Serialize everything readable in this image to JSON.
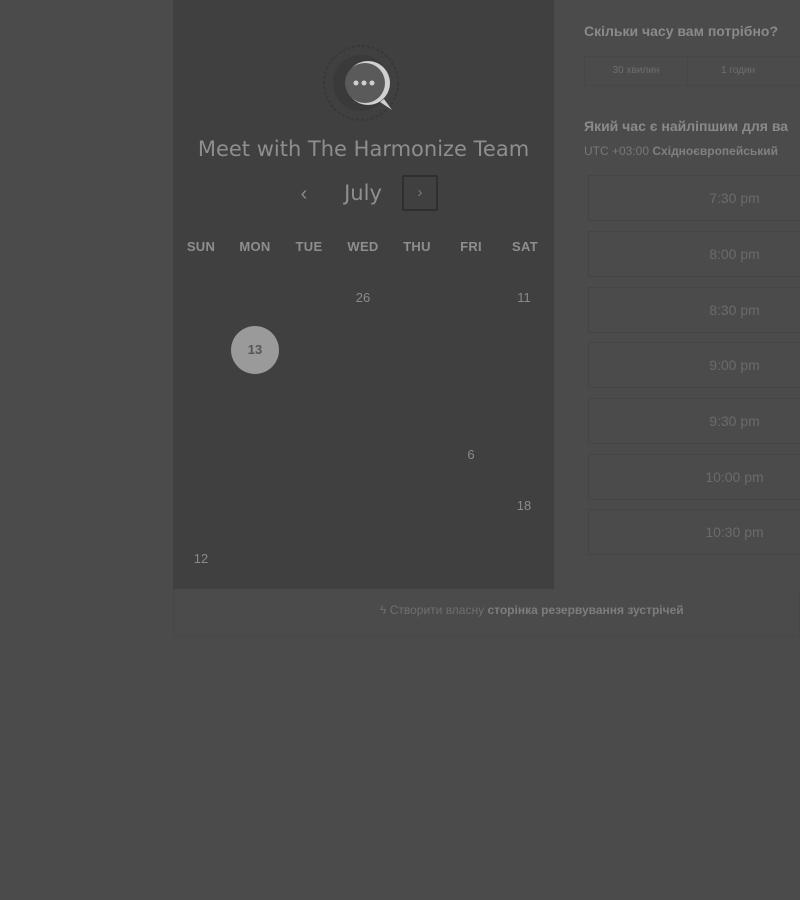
{
  "calendar": {
    "title": "Meet with The Harmonize Team",
    "month": "July",
    "prev_icon": "‹",
    "next_icon": "›",
    "weekdays": [
      "SUN",
      "MON",
      "TUE",
      "WED",
      "THU",
      "FRI",
      "SAT"
    ],
    "days": {
      "d26": "26",
      "d11": "11",
      "d13": "13",
      "d6": "6",
      "d18": "18",
      "d12": "12"
    },
    "selected_day": "13"
  },
  "booking": {
    "duration_question": "Скільки часу вам потрібно?",
    "durations": [
      "30 хвилин",
      "1 годин"
    ],
    "best_time_question": "Який час є найліпшим для ва",
    "timezone_prefix": "UTC +03:00",
    "timezone_name": "Східноєвропейський",
    "slots": [
      "7:30 pm",
      "8:00 pm",
      "8:30 pm",
      "9:00 pm",
      "9:30 pm",
      "10:00 pm",
      "10:30 pm"
    ]
  },
  "footer": {
    "icon": "ϟ",
    "prefix": "Створити власну",
    "link": "сторінка резервування зустрічей"
  }
}
